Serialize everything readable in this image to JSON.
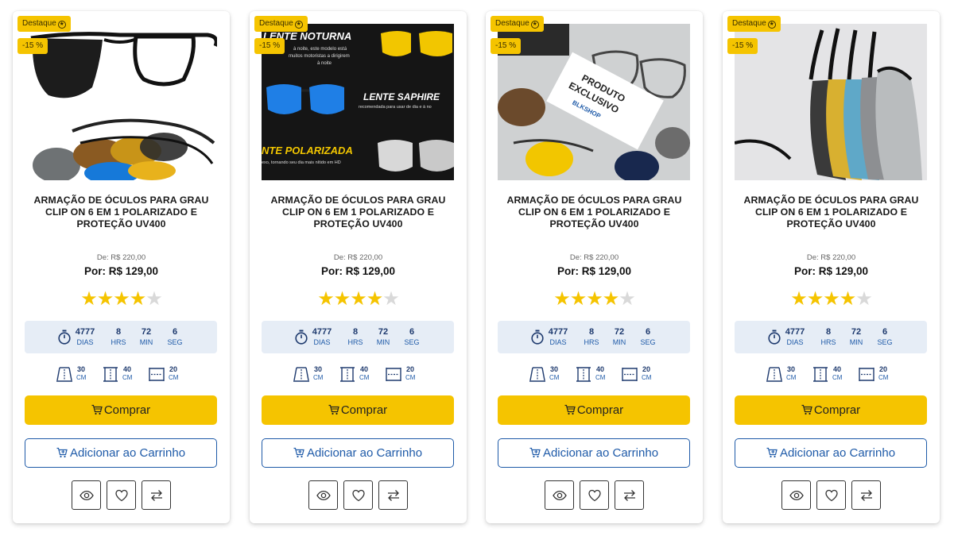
{
  "products": [
    {
      "badge_featured": "Destaque",
      "badge_discount": "-15 %",
      "image_texts": [],
      "title": "ARMAÇÃO DE ÓCULOS PARA GRAU CLIP ON 6 EM 1 POLARIZADO E PROTEÇÃO UV400",
      "old_price": "De: R$ 220,00",
      "new_price": "Por: R$ 129,00",
      "rating": 4,
      "rating_max": 5,
      "countdown": [
        {
          "value": "4777",
          "label": "DIAS"
        },
        {
          "value": "8",
          "label": "HRS"
        },
        {
          "value": "72",
          "label": "MIN"
        },
        {
          "value": "6",
          "label": "SEG"
        }
      ],
      "dimensions": [
        {
          "value": "30",
          "unit": "CM",
          "icon": "width-dimension-icon"
        },
        {
          "value": "40",
          "unit": "CM",
          "icon": "height-dimension-icon"
        },
        {
          "value": "20",
          "unit": "CM",
          "icon": "depth-dimension-icon"
        }
      ],
      "buy_label": "Comprar",
      "cart_label": "Adicionar ao Carrinho"
    },
    {
      "badge_featured": "Destaque",
      "badge_discount": "-15 %",
      "image_texts": {
        "t1": "LENTE NOTURNA",
        "t1a": "à noite, este modelo está",
        "t1b": "muitos motoristas a dirigirem",
        "t1c": "à noite",
        "t2": "LENTE SAPHIRE",
        "t2a": "recomendada para usar de dia e à no",
        "t3": "NTE POLARIZADA",
        "t3a": "exo, tornando seu dia mais nítido em HD"
      },
      "title": "ARMAÇÃO DE ÓCULOS PARA GRAU CLIP ON 6 EM 1 POLARIZADO E PROTEÇÃO UV400",
      "old_price": "De: R$ 220,00",
      "new_price": "Por: R$ 129,00",
      "rating": 4,
      "rating_max": 5,
      "countdown": [
        {
          "value": "4777",
          "label": "DIAS"
        },
        {
          "value": "8",
          "label": "HRS"
        },
        {
          "value": "72",
          "label": "MIN"
        },
        {
          "value": "6",
          "label": "SEG"
        }
      ],
      "dimensions": [
        {
          "value": "30",
          "unit": "CM",
          "icon": "width-dimension-icon"
        },
        {
          "value": "40",
          "unit": "CM",
          "icon": "height-dimension-icon"
        },
        {
          "value": "20",
          "unit": "CM",
          "icon": "depth-dimension-icon"
        }
      ],
      "buy_label": "Comprar",
      "cart_label": "Adicionar ao Carrinho"
    },
    {
      "badge_featured": "Destaque",
      "badge_discount": "-15 %",
      "image_texts": {
        "t1": "PRODUTO",
        "t2": "EXCLUSIVO",
        "t3": "BLKSHOP"
      },
      "title": "ARMAÇÃO DE ÓCULOS PARA GRAU CLIP ON 6 EM 1 POLARIZADO E PROTEÇÃO UV400",
      "old_price": "De: R$ 220,00",
      "new_price": "Por: R$ 129,00",
      "rating": 4,
      "rating_max": 5,
      "countdown": [
        {
          "value": "4777",
          "label": "DIAS"
        },
        {
          "value": "8",
          "label": "HRS"
        },
        {
          "value": "72",
          "label": "MIN"
        },
        {
          "value": "6",
          "label": "SEG"
        }
      ],
      "dimensions": [
        {
          "value": "30",
          "unit": "CM",
          "icon": "width-dimension-icon"
        },
        {
          "value": "40",
          "unit": "CM",
          "icon": "height-dimension-icon"
        },
        {
          "value": "20",
          "unit": "CM",
          "icon": "depth-dimension-icon"
        }
      ],
      "buy_label": "Comprar",
      "cart_label": "Adicionar ao Carrinho"
    },
    {
      "badge_featured": "Destaque",
      "badge_discount": "-15 %",
      "image_texts": [],
      "title": "ARMAÇÃO DE ÓCULOS PARA GRAU CLIP ON 6 EM 1 POLARIZADO E PROTEÇÃO UV400",
      "old_price": "De: R$ 220,00",
      "new_price": "Por: R$ 129,00",
      "rating": 4,
      "rating_max": 5,
      "countdown": [
        {
          "value": "4777",
          "label": "DIAS"
        },
        {
          "value": "8",
          "label": "HRS"
        },
        {
          "value": "72",
          "label": "MIN"
        },
        {
          "value": "6",
          "label": "SEG"
        }
      ],
      "dimensions": [
        {
          "value": "30",
          "unit": "CM",
          "icon": "width-dimension-icon"
        },
        {
          "value": "40",
          "unit": "CM",
          "icon": "height-dimension-icon"
        },
        {
          "value": "20",
          "unit": "CM",
          "icon": "depth-dimension-icon"
        }
      ],
      "buy_label": "Comprar",
      "cart_label": "Adicionar ao Carrinho"
    }
  ],
  "actions": [
    {
      "name": "quick-view-button",
      "icon": "eye-icon"
    },
    {
      "name": "wishlist-button",
      "icon": "heart-icon"
    },
    {
      "name": "compare-button",
      "icon": "compare-arrows-icon"
    }
  ],
  "colors": {
    "accent_yellow": "#f5c400",
    "brand_blue": "#1e5aa8",
    "timer_bg": "#e6edf6",
    "star_off": "#d9d9d9"
  }
}
